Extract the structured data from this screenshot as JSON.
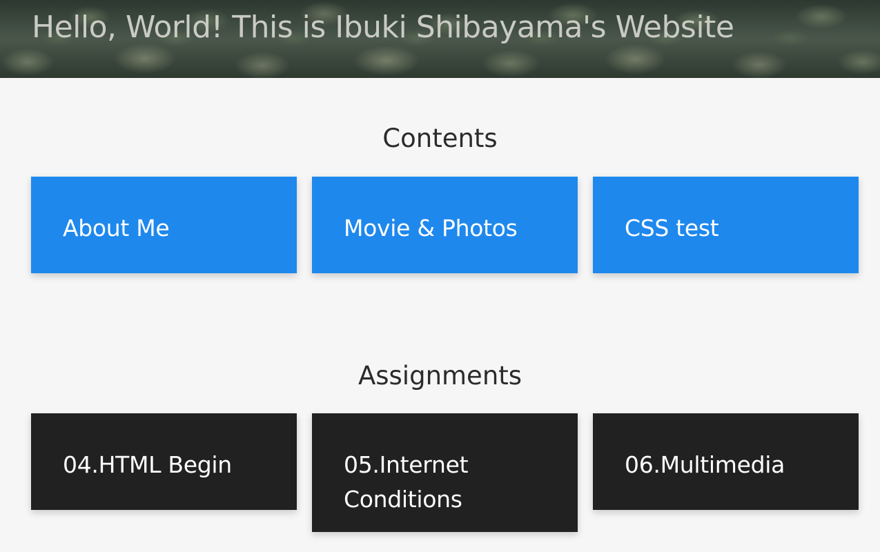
{
  "header": {
    "title": "Hello, World! This is Ibuki Shibayama's Website"
  },
  "sections": [
    {
      "heading": "Contents",
      "items": [
        {
          "label": "About Me"
        },
        {
          "label": "Movie & Photos"
        },
        {
          "label": "CSS test"
        }
      ]
    },
    {
      "heading": "Assignments",
      "items": [
        {
          "label": "04.HTML Begin"
        },
        {
          "label": "05.Internet Conditions"
        },
        {
          "label": "06.Multimedia"
        }
      ]
    }
  ],
  "colors": {
    "contents_card": "#1e88ed",
    "assignments_card": "#212121",
    "page_background": "#f6f6f6"
  }
}
